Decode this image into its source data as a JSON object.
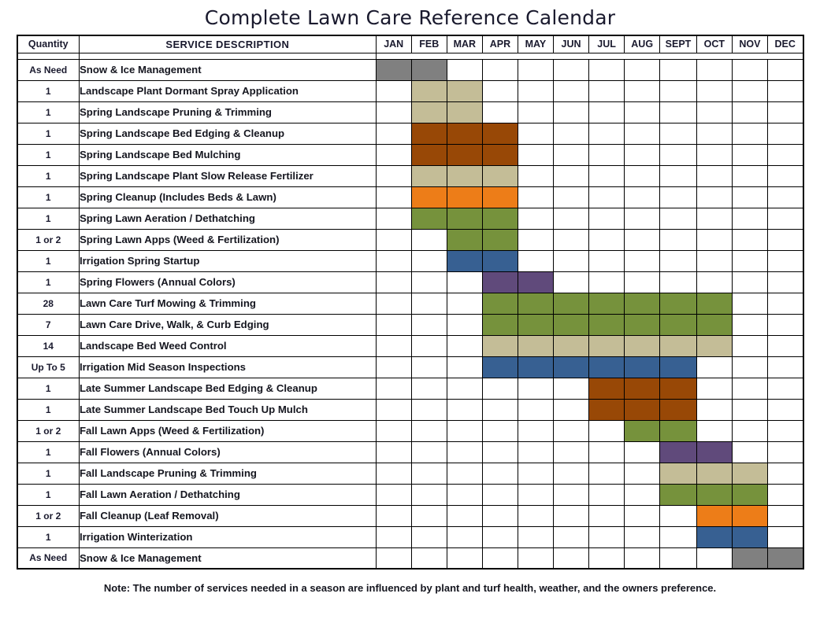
{
  "title": "Complete Lawn Care Reference Calendar",
  "footer_note": "Note: The number of services needed in a season are influenced by plant and turf health, weather, and the owners preference.",
  "headers": {
    "quantity": "Quantity",
    "description": "SERVICE DESCRIPTION",
    "months": [
      "JAN",
      "FEB",
      "MAR",
      "APR",
      "MAY",
      "JUN",
      "JUL",
      "AUG",
      "SEPT",
      "OCT",
      "NOV",
      "DEC"
    ]
  },
  "palette": {
    "gray": "#808080",
    "tan": "#C4BD97",
    "brown": "#984806",
    "orange": "#ED7D18",
    "green": "#76923C",
    "blue": "#376092",
    "purple": "#604A7B",
    "empty": "#FFFFFF"
  },
  "rows": [
    {
      "quantity": "As Need",
      "description": "Snow & Ice Management",
      "months": [
        "gray",
        "gray",
        "",
        "",
        "",
        "",
        "",
        "",
        "",
        "",
        "",
        ""
      ]
    },
    {
      "quantity": "1",
      "description": "Landscape Plant Dormant Spray Application",
      "months": [
        "",
        "tan",
        "tan",
        "",
        "",
        "",
        "",
        "",
        "",
        "",
        "",
        ""
      ]
    },
    {
      "quantity": "1",
      "description": "Spring Landscape Pruning & Trimming",
      "months": [
        "",
        "tan",
        "tan",
        "",
        "",
        "",
        "",
        "",
        "",
        "",
        "",
        ""
      ]
    },
    {
      "quantity": "1",
      "description": "Spring Landscape Bed Edging & Cleanup",
      "months": [
        "",
        "brown",
        "brown",
        "brown",
        "",
        "",
        "",
        "",
        "",
        "",
        "",
        ""
      ]
    },
    {
      "quantity": "1",
      "description": "Spring Landscape Bed Mulching",
      "months": [
        "",
        "brown",
        "brown",
        "brown",
        "",
        "",
        "",
        "",
        "",
        "",
        "",
        ""
      ]
    },
    {
      "quantity": "1",
      "description": "Spring Landscape Plant Slow Release Fertilizer",
      "months": [
        "",
        "tan",
        "tan",
        "tan",
        "",
        "",
        "",
        "",
        "",
        "",
        "",
        ""
      ]
    },
    {
      "quantity": "1",
      "description": "Spring Cleanup (Includes Beds & Lawn)",
      "months": [
        "",
        "orange",
        "orange",
        "orange",
        "",
        "",
        "",
        "",
        "",
        "",
        "",
        ""
      ]
    },
    {
      "quantity": "1",
      "description": "Spring Lawn Aeration / Dethatching",
      "months": [
        "",
        "green",
        "green",
        "green",
        "",
        "",
        "",
        "",
        "",
        "",
        "",
        ""
      ]
    },
    {
      "quantity": "1 or 2",
      "description": "Spring Lawn Apps (Weed & Fertilization)",
      "months": [
        "",
        "",
        "green",
        "green",
        "",
        "",
        "",
        "",
        "",
        "",
        "",
        ""
      ]
    },
    {
      "quantity": "1",
      "description": "Irrigation Spring Startup",
      "months": [
        "",
        "",
        "blue",
        "blue",
        "",
        "",
        "",
        "",
        "",
        "",
        "",
        ""
      ]
    },
    {
      "quantity": "1",
      "description": "Spring Flowers (Annual Colors)",
      "months": [
        "",
        "",
        "",
        "purple",
        "purple",
        "",
        "",
        "",
        "",
        "",
        "",
        ""
      ]
    },
    {
      "quantity": "28",
      "description": "Lawn Care Turf Mowing & Trimming",
      "months": [
        "",
        "",
        "",
        "green",
        "green",
        "green",
        "green",
        "green",
        "green",
        "green",
        "",
        ""
      ]
    },
    {
      "quantity": "7",
      "description": "Lawn Care Drive, Walk, & Curb Edging",
      "months": [
        "",
        "",
        "",
        "green",
        "green",
        "green",
        "green",
        "green",
        "green",
        "green",
        "",
        ""
      ]
    },
    {
      "quantity": "14",
      "description": "Landscape Bed Weed Control",
      "months": [
        "",
        "",
        "",
        "tan",
        "tan",
        "tan",
        "tan",
        "tan",
        "tan",
        "tan",
        "",
        ""
      ]
    },
    {
      "quantity": "Up To 5",
      "description": "Irrigation Mid Season Inspections",
      "months": [
        "",
        "",
        "",
        "blue",
        "blue",
        "blue",
        "blue",
        "blue",
        "blue",
        "",
        "",
        ""
      ]
    },
    {
      "quantity": "1",
      "description": "Late Summer Landscape Bed Edging & Cleanup",
      "months": [
        "",
        "",
        "",
        "",
        "",
        "",
        "brown",
        "brown",
        "brown",
        "",
        "",
        ""
      ]
    },
    {
      "quantity": "1",
      "description": "Late Summer Landscape Bed Touch Up Mulch",
      "months": [
        "",
        "",
        "",
        "",
        "",
        "",
        "brown",
        "brown",
        "brown",
        "",
        "",
        ""
      ]
    },
    {
      "quantity": "1 or 2",
      "description": "Fall Lawn Apps (Weed & Fertilization)",
      "months": [
        "",
        "",
        "",
        "",
        "",
        "",
        "",
        "green",
        "green",
        "",
        "",
        ""
      ]
    },
    {
      "quantity": "1",
      "description": "Fall Flowers (Annual Colors)",
      "months": [
        "",
        "",
        "",
        "",
        "",
        "",
        "",
        "",
        "purple",
        "purple",
        "",
        ""
      ]
    },
    {
      "quantity": "1",
      "description": "Fall Landscape Pruning & Trimming",
      "months": [
        "",
        "",
        "",
        "",
        "",
        "",
        "",
        "",
        "tan",
        "tan",
        "tan",
        ""
      ]
    },
    {
      "quantity": "1",
      "description": "Fall Lawn Aeration / Dethatching",
      "months": [
        "",
        "",
        "",
        "",
        "",
        "",
        "",
        "",
        "green",
        "green",
        "green",
        ""
      ]
    },
    {
      "quantity": "1 or 2",
      "description": "Fall Cleanup (Leaf Removal)",
      "months": [
        "",
        "",
        "",
        "",
        "",
        "",
        "",
        "",
        "",
        "orange",
        "orange",
        ""
      ]
    },
    {
      "quantity": "1",
      "description": "Irrigation Winterization",
      "months": [
        "",
        "",
        "",
        "",
        "",
        "",
        "",
        "",
        "",
        "blue",
        "blue",
        ""
      ]
    },
    {
      "quantity": "As Need",
      "description": "Snow & Ice Management",
      "months": [
        "",
        "",
        "",
        "",
        "",
        "",
        "",
        "",
        "",
        "",
        "gray",
        "gray"
      ]
    }
  ]
}
